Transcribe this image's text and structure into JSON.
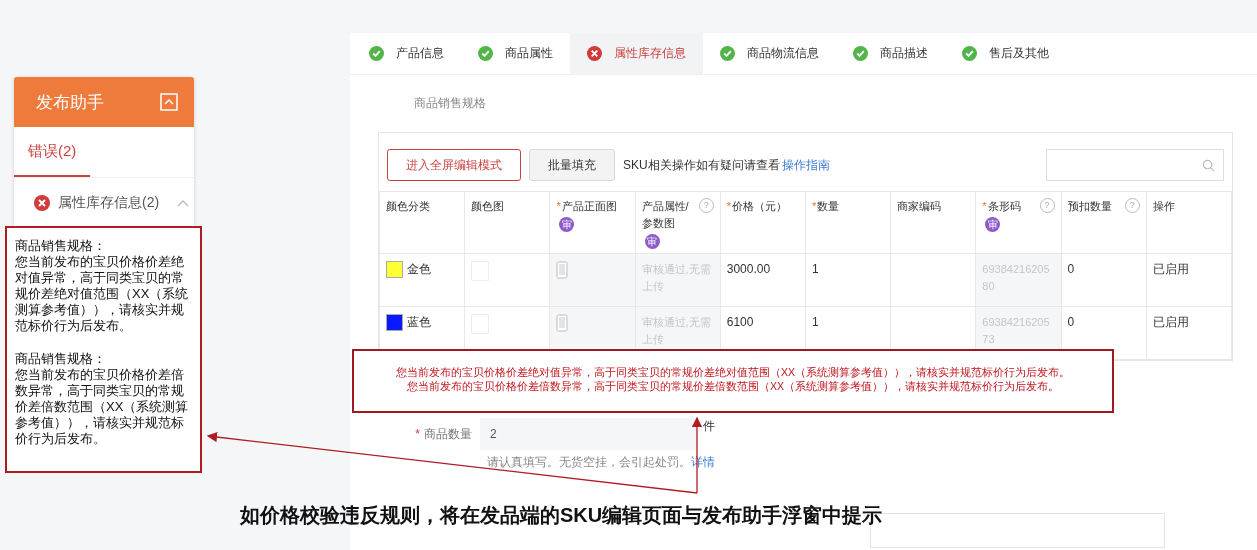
{
  "helper": {
    "title": "发布助手",
    "tabs": [
      {
        "label": "错误(2)",
        "selected": true
      }
    ],
    "section": {
      "label": "属性库存信息(2)",
      "passed": false,
      "expanded": true
    }
  },
  "steps": [
    {
      "label": "产品信息",
      "passed": true,
      "selected": false
    },
    {
      "label": "商品属性",
      "passed": true,
      "selected": false
    },
    {
      "label": "属性库存信息",
      "passed": false,
      "selected": true
    },
    {
      "label": "商品物流信息",
      "passed": true,
      "selected": false
    },
    {
      "label": "商品描述",
      "passed": true,
      "selected": false
    },
    {
      "label": "售后及其他",
      "passed": true,
      "selected": false
    }
  ],
  "section_title": "商品销售规格",
  "toolbar": {
    "primary_button": "进入全屏编辑模式",
    "secondary_button": "批量填充",
    "hint": "SKU相关操作如有疑问请查看",
    "link": "操作指南"
  },
  "table": {
    "columns": [
      {
        "label": "颜色分类"
      },
      {
        "label": "颜色图"
      },
      {
        "label": "产品正面图",
        "mark": "*",
        "badge": "审"
      },
      {
        "label": "产品属性/参数图",
        "badge": "审",
        "help": "?"
      },
      {
        "label": "价格（元）",
        "mark": "*"
      },
      {
        "label": "数量",
        "mark": "*"
      },
      {
        "label": "商家编码"
      },
      {
        "label": "条形码",
        "mark": "*",
        "badge": "审",
        "help": "?"
      },
      {
        "label": "预扣数量",
        "help": "?"
      },
      {
        "label": "操作"
      }
    ],
    "rows": [
      {
        "color": "#ffff33",
        "color_name": "金色",
        "attr_image": "审核通过,无需上传",
        "price": "3000.00",
        "quantity": "1",
        "barcode": "6938421620580",
        "reserved": "0",
        "action": "已启用"
      },
      {
        "color": "#0a1aff",
        "color_name": "蓝色",
        "attr_image": "审核通过,无需上传",
        "price": "6100",
        "quantity": "1",
        "barcode": "6938421620573",
        "reserved": "0",
        "action": "已启用"
      }
    ]
  },
  "quantity_field": {
    "label": "商品数量",
    "mark": "*",
    "value": "2",
    "unit": "件",
    "hint": "请认真填写。无货空挂，会引起处罚。",
    "link": "详情"
  },
  "callout_left": [
    {
      "heading": "商品销售规格：",
      "body": "您当前发布的宝贝价格价差绝对值异常，高于同类宝贝的常规价差绝对值范围（XX（系统测算参考值）），请核实并规范标价行为后发布。"
    },
    {
      "heading": "商品销售规格：",
      "body": "您当前发布的宝贝价格价差倍数异常，高于同类宝贝的常规价差倍数范围（XX（系统测算参考值）），请核实并规范标价行为后发布。"
    }
  ],
  "callout_table": [
    "您当前发布的宝贝价格价差绝对值异常，高于同类宝贝的常规价差绝对值范围（XX（系统测算参考值）），请核实并规范标价行为后发布。",
    "您当前发布的宝贝价格价差倍数异常，高于同类宝贝的常规价差倍数范围（XX（系统测算参考值）），请核实并规范标价行为后发布。"
  ],
  "caption": "如价格校验违反规则，将在发品端的SKU编辑页面与发布助手浮窗中提示"
}
